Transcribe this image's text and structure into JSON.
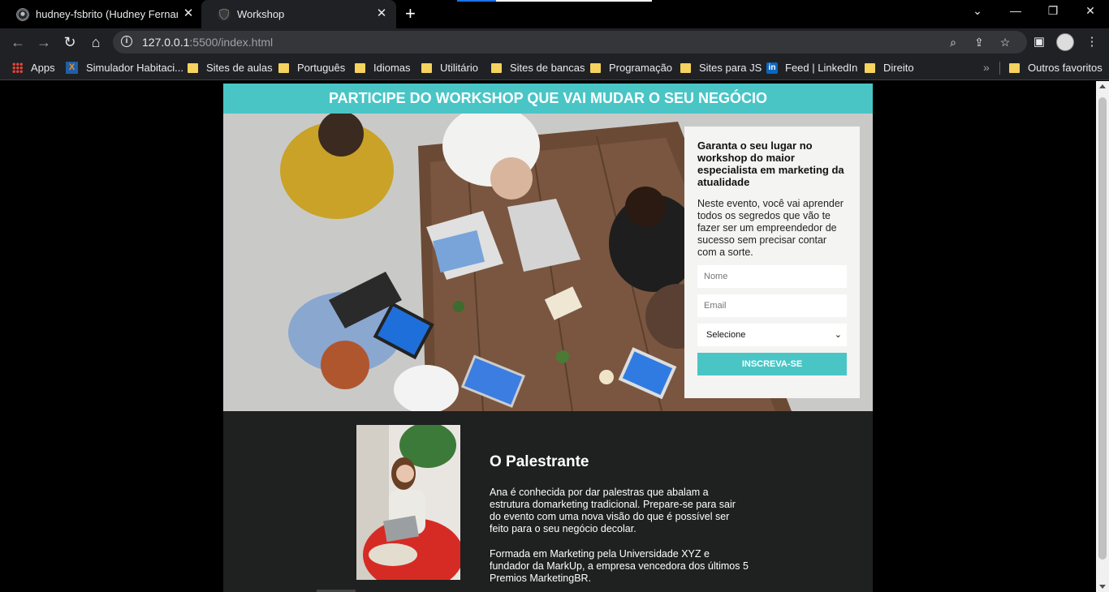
{
  "browser": {
    "tabs": [
      {
        "title": "hudney-fsbrito (Hudney Fernand",
        "icon": "github-icon",
        "active": false
      },
      {
        "title": "Workshop",
        "icon": "shield-icon",
        "active": true
      }
    ],
    "url_host": "127.0.0.1",
    "url_path": ":5500/index.html",
    "bookmarks": [
      {
        "label": "Apps",
        "icon": "apps-grid-icon"
      },
      {
        "label": "Simulador Habitaci...",
        "icon": "caixa-icon"
      },
      {
        "label": "Sites de aulas",
        "icon": "folder-icon"
      },
      {
        "label": "Português",
        "icon": "folder-icon"
      },
      {
        "label": "Idiomas",
        "icon": "folder-icon"
      },
      {
        "label": "Utilitário",
        "icon": "folder-icon"
      },
      {
        "label": "Sites de bancas",
        "icon": "folder-icon"
      },
      {
        "label": "Programação",
        "icon": "folder-icon"
      },
      {
        "label": "Sites para JS",
        "icon": "folder-icon"
      },
      {
        "label": "Feed | LinkedIn",
        "icon": "linkedin-icon"
      },
      {
        "label": "Direito",
        "icon": "folder-icon"
      }
    ],
    "other_bookmarks": "Outros favoritos"
  },
  "page": {
    "banner": "PARTICIPE DO WORKSHOP QUE VAI MUDAR O SEU NEGÓCIO",
    "form": {
      "heading": "Garanta o seu lugar no workshop do maior especialista em marketing da atualidade",
      "description": "Neste evento, você vai aprender todos os segredos que vão te fazer ser um empreendedor de sucesso sem precisar contar com a sorte.",
      "name_placeholder": "Nome",
      "email_placeholder": "Email",
      "select_value": "Selecione",
      "submit_label": "INSCREVA-SE"
    },
    "speaker": {
      "title": "O Palestrante",
      "bio1": "Ana é conhecida por dar palestras que abalam a estrutura domarketing tradicional. Prepare-se para sair do evento com uma nova visão do que é possível ser feito para o seu negócio decolar.",
      "bio2": "Formada em Marketing pela Universidade XYZ e fundador da MarkUp, a empresa vencedora dos últimos 5 Premios MarketingBR."
    }
  },
  "colors": {
    "accent": "#49c5c6",
    "speaker_bg": "#1f2020",
    "card_bg": "#f4f4f2"
  }
}
